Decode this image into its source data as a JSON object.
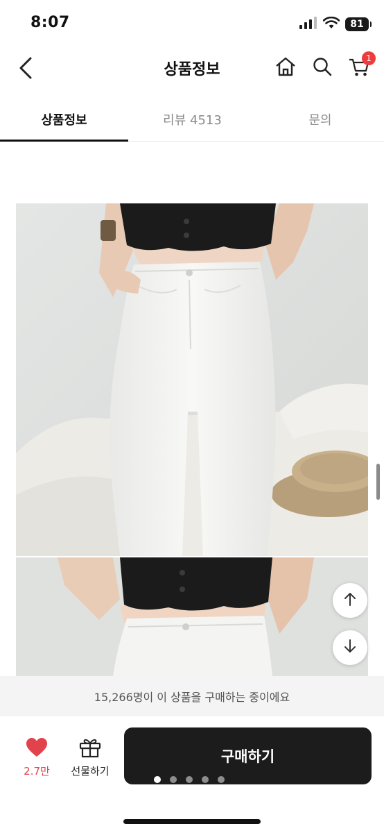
{
  "status_bar": {
    "time": "8:07",
    "battery": "81",
    "icons": [
      "cellular-signal-icon",
      "wifi-icon",
      "battery-icon"
    ]
  },
  "header": {
    "title": "상품정보",
    "cart_count": "1",
    "icons": [
      "back-chevron-icon",
      "home-icon",
      "search-icon",
      "cart-icon"
    ]
  },
  "tabs": [
    {
      "label": "상품정보",
      "active": true
    },
    {
      "label": "리뷰 4513",
      "active": false
    },
    {
      "label": "문의",
      "active": false
    }
  ],
  "banner": {
    "text": "15,266명이 이 상품을 구매하는 중이에요"
  },
  "bottom_bar": {
    "like_count": "2.7만",
    "gift_label": "선물하기",
    "buy_label": "구매하기",
    "pagination": {
      "pages": 5,
      "current": 1
    }
  },
  "colors": {
    "accent_red": "#e2424b",
    "buy_button": "#1c1c1c",
    "badge": "#ee3b3b"
  }
}
